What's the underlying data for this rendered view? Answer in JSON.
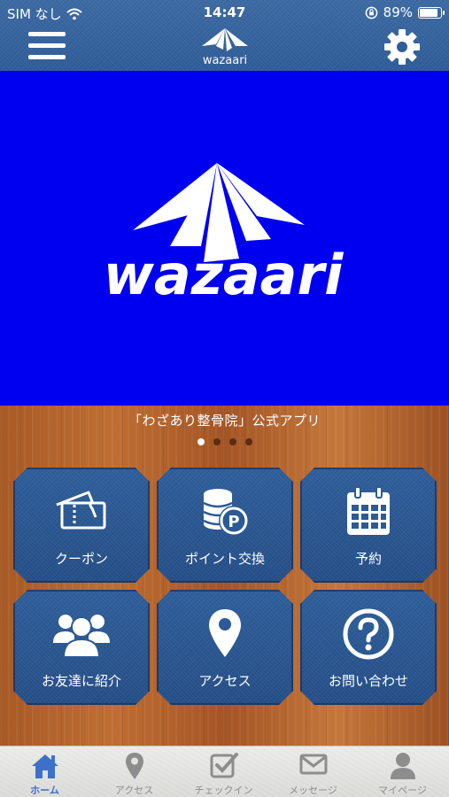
{
  "status": {
    "carrier": "SIM なし",
    "time": "14:47",
    "battery": "89%"
  },
  "header": {
    "logo_text": "wazaari"
  },
  "hero": {
    "logo_text": "wazaari"
  },
  "caption": "「わざあり整骨院」公式アプリ",
  "carousel": {
    "count": 4,
    "active": 0
  },
  "tiles": [
    {
      "label": "クーポン",
      "icon": "ticket-icon"
    },
    {
      "label": "ポイント交換",
      "icon": "coins-point-icon"
    },
    {
      "label": "予約",
      "icon": "calendar-icon"
    },
    {
      "label": "お友達に紹介",
      "icon": "people-icon"
    },
    {
      "label": "アクセス",
      "icon": "map-pin-icon"
    },
    {
      "label": "お問い合わせ",
      "icon": "question-icon"
    }
  ],
  "tabs": [
    {
      "label": "ホーム",
      "icon": "home-icon",
      "active": true
    },
    {
      "label": "アクセス",
      "icon": "map-pin-icon",
      "active": false
    },
    {
      "label": "チェックイン",
      "icon": "checkin-icon",
      "active": false
    },
    {
      "label": "メッセージ",
      "icon": "envelope-icon",
      "active": false
    },
    {
      "label": "マイページ",
      "icon": "user-icon",
      "active": false
    }
  ],
  "colors": {
    "header": "#2f5d98",
    "hero_bg": "#0000f0",
    "tile": "#2b5a96",
    "tab_active": "#3c71c8",
    "tab_inactive": "#8d8d8d"
  }
}
